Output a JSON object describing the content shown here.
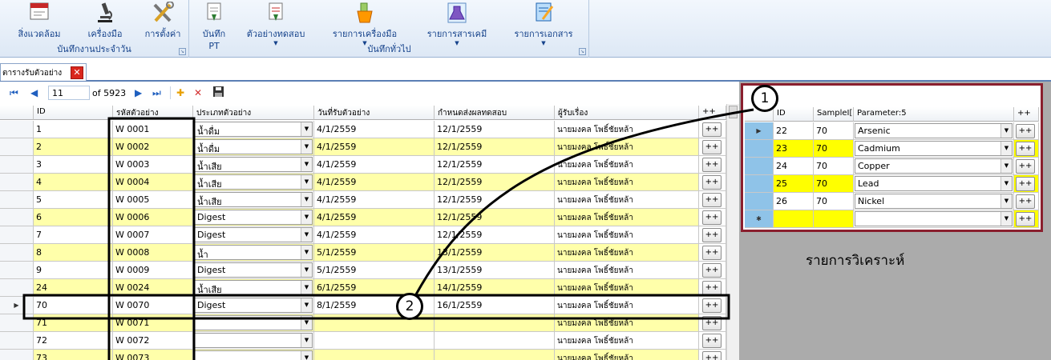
{
  "ribbon": {
    "groups": [
      {
        "label": "บันทึกงานประจำวัน",
        "buttons": [
          {
            "label": "สิ่งแวดล้อม",
            "icon": "environment-icon"
          },
          {
            "label": "เครื่องมือ",
            "icon": "microscope-icon"
          },
          {
            "label": "การตั้งค่า",
            "icon": "tools-icon"
          }
        ]
      },
      {
        "label": "บันทึกทั่วไป",
        "buttons": [
          {
            "label": "บันทึก",
            "label2": "PT",
            "icon": "record-icon"
          },
          {
            "label": "ตัวอย่างทดสอบ",
            "icon": "sample-icon"
          },
          {
            "label": "รายการเครื่องมือ",
            "icon": "instrument-list-icon"
          },
          {
            "label": "รายการสารเคมี",
            "icon": "chemical-list-icon"
          },
          {
            "label": "รายการเอกสาร",
            "icon": "document-list-icon"
          }
        ]
      }
    ]
  },
  "tab": {
    "label": "ตารางรับตัวอย่าง",
    "close": "✕"
  },
  "navigator": {
    "position": "11",
    "of_text": "of 5923"
  },
  "colors": {
    "highlight_yellow": "#ffffaa",
    "frame_red": "#8a1f2e",
    "ribbon_text": "#15428b"
  },
  "main_grid": {
    "headers": [
      "ID",
      "รหัสตัวอย่าง",
      "ประเภทตัวอย่าง",
      "วันที่รับตัวอย่าง",
      "กำหนดส่งผลทดสอบ",
      "ผู้รับเรื่อง",
      "++"
    ],
    "rows": [
      {
        "id": "1",
        "code": "W 0001",
        "type": "น้ำดื่ม",
        "received": "4/1/2559",
        "due": "12/1/2559",
        "receiver": "นายมงคล โพธิ์ชัยหล้า",
        "btn": "++",
        "hl": false
      },
      {
        "id": "2",
        "code": "W 0002",
        "type": "น้ำดื่ม",
        "received": "4/1/2559",
        "due": "12/1/2559",
        "receiver": "นายมงคล โพธิ์ชัยหล้า",
        "btn": "++",
        "hl": true
      },
      {
        "id": "3",
        "code": "W 0003",
        "type": "น้ำเสีย",
        "received": "4/1/2559",
        "due": "12/1/2559",
        "receiver": "นายมงคล โพธิ์ชัยหล้า",
        "btn": "++",
        "hl": false
      },
      {
        "id": "4",
        "code": "W 0004",
        "type": "น้ำเสีย",
        "received": "4/1/2559",
        "due": "12/1/2559",
        "receiver": "นายมงคล โพธิ์ชัยหล้า",
        "btn": "++",
        "hl": true
      },
      {
        "id": "5",
        "code": "W 0005",
        "type": "น้ำเสีย",
        "received": "4/1/2559",
        "due": "12/1/2559",
        "receiver": "นายมงคล โพธิ์ชัยหล้า",
        "btn": "++",
        "hl": false
      },
      {
        "id": "6",
        "code": "W 0006",
        "type": "Digest",
        "received": "4/1/2559",
        "due": "12/1/2559",
        "receiver": "นายมงคล โพธิ์ชัยหล้า",
        "btn": "++",
        "hl": true
      },
      {
        "id": "7",
        "code": "W 0007",
        "type": "Digest",
        "received": "4/1/2559",
        "due": "12/1/2559",
        "receiver": "นายมงคล โพธิ์ชัยหล้า",
        "btn": "++",
        "hl": false
      },
      {
        "id": "8",
        "code": "W 0008",
        "type": "น้ำ",
        "received": "5/1/2559",
        "due": "13/1/2559",
        "receiver": "นายมงคล โพธิ์ชัยหล้า",
        "btn": "++",
        "hl": true
      },
      {
        "id": "9",
        "code": "W 0009",
        "type": "Digest",
        "received": "5/1/2559",
        "due": "13/1/2559",
        "receiver": "นายมงคล โพธิ์ชัยหล้า",
        "btn": "++",
        "hl": false
      },
      {
        "id": "24",
        "code": "W 0024",
        "type": "น้ำเสีย",
        "received": "6/1/2559",
        "due": "14/1/2559",
        "receiver": "นายมงคล โพธิ์ชัยหล้า",
        "btn": "++",
        "hl": true
      },
      {
        "id": "70",
        "code": "W 0070",
        "type": "Digest",
        "received": "8/1/2559",
        "due": "16/1/2559",
        "receiver": "นายมงคล โพธิ์ชัยหล้า",
        "btn": "++",
        "hl": false,
        "current": true
      },
      {
        "id": "71",
        "code": "W 0071",
        "type": "",
        "received": "",
        "due": "",
        "receiver": "นายมงคล โพธิ์ชัยหล้า",
        "btn": "++",
        "hl": true
      },
      {
        "id": "72",
        "code": "W 0072",
        "type": "",
        "received": "",
        "due": "",
        "receiver": "นายมงคล โพธิ์ชัยหล้า",
        "btn": "++",
        "hl": false
      },
      {
        "id": "73",
        "code": "W 0073",
        "type": "",
        "received": "",
        "due": "",
        "receiver": "นายมงคล โพธิ์ชัยหล้า",
        "btn": "++",
        "hl": true
      }
    ]
  },
  "detail_grid": {
    "headers": [
      "ID",
      "SampleI[",
      "Parameter:5",
      "++"
    ],
    "rows": [
      {
        "id": "22",
        "sample": "70",
        "param": "Arsenic",
        "btn": "++",
        "hl": false
      },
      {
        "id": "23",
        "sample": "70",
        "param": "Cadmium",
        "btn": "++",
        "hl": true
      },
      {
        "id": "24",
        "sample": "70",
        "param": "Copper",
        "btn": "++",
        "hl": false
      },
      {
        "id": "25",
        "sample": "70",
        "param": "Lead",
        "btn": "++",
        "hl": true
      },
      {
        "id": "26",
        "sample": "70",
        "param": "Nickel",
        "btn": "++",
        "hl": false
      },
      {
        "id": "",
        "sample": "",
        "param": "",
        "btn": "++",
        "hl": true,
        "new": true
      }
    ]
  },
  "caption": "รายการวิเคราะห์",
  "annotations": [
    "1",
    "2"
  ]
}
